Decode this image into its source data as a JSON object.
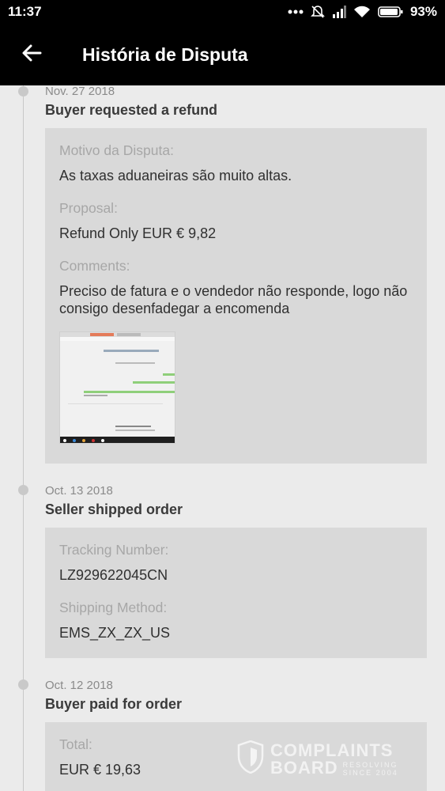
{
  "status_bar": {
    "time": "11:37",
    "battery": "93%"
  },
  "app_bar": {
    "title": "História de Disputa"
  },
  "events": [
    {
      "date": "Nov. 27 2018",
      "title": "Buyer requested a refund",
      "fields": [
        {
          "label": "Motivo da Disputa:",
          "value": "As taxas aduaneiras são muito altas."
        },
        {
          "label": "Proposal:",
          "value": "Refund Only EUR € 9,82"
        },
        {
          "label": "Comments:",
          "value": "Preciso de fatura e o vendedor não responde, logo não consigo desenfadegar a encomenda"
        }
      ]
    },
    {
      "date": "Oct. 13 2018",
      "title": "Seller shipped order",
      "fields": [
        {
          "label": "Tracking Number:",
          "value": "LZ929622045CN"
        },
        {
          "label": "Shipping Method:",
          "value": "EMS_ZX_ZX_US"
        }
      ]
    },
    {
      "date": "Oct. 12 2018",
      "title": "Buyer paid for order",
      "fields": [
        {
          "label": "Total:",
          "value": "EUR € 19,63"
        }
      ]
    }
  ],
  "watermark": {
    "line1": "COMPLAINTS",
    "line2": "BOARD",
    "tag1": "RESOLVING",
    "tag2": "SINCE 2004"
  }
}
